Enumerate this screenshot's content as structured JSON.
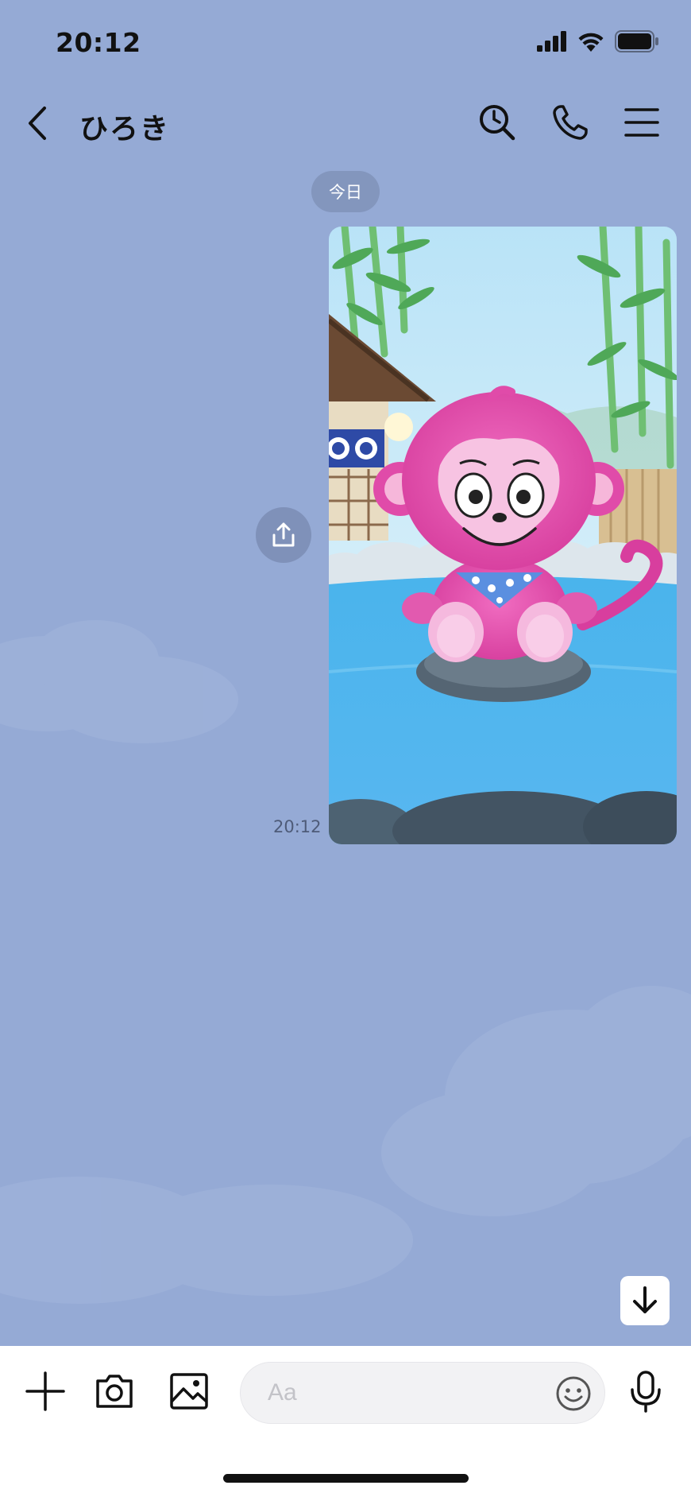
{
  "status_bar": {
    "time": "20:12"
  },
  "header": {
    "title": "ひろき"
  },
  "chat": {
    "date_label": "今日",
    "messages": [
      {
        "type": "image",
        "time": "20:12"
      }
    ]
  },
  "composer": {
    "placeholder": "Aa"
  }
}
